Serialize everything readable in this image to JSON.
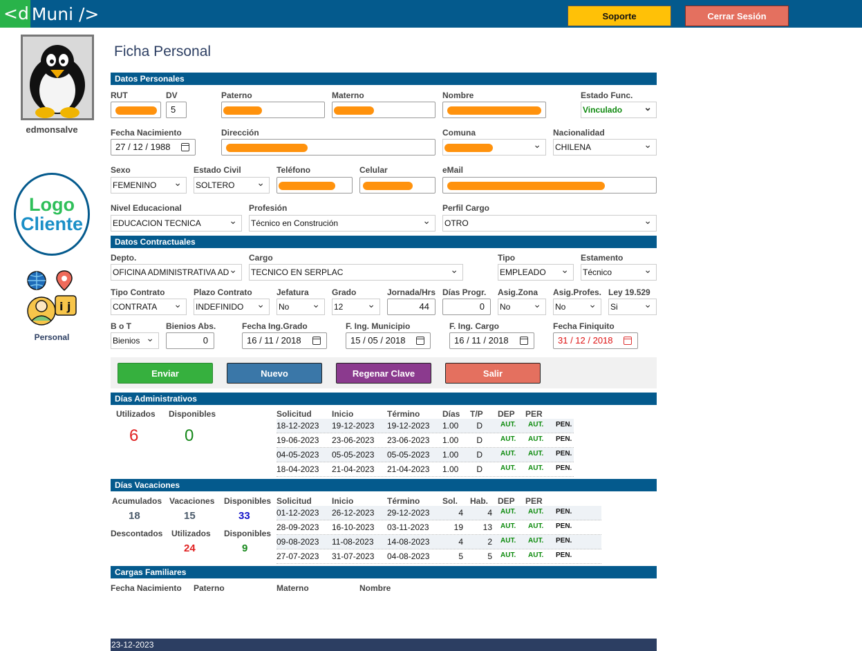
{
  "app": {
    "logo_tag": "<d",
    "logo_rest": "Muni />"
  },
  "header": {
    "support_label": "Soporte",
    "logout_label": "Cerrar Sesión"
  },
  "colors": {
    "primary": "#045a8d",
    "navy": "#2c3e62",
    "support": "#ffc107",
    "logout": "#e4705f",
    "send": "#36b03e",
    "new": "#3a77a8",
    "regen": "#8b3a8e",
    "exit": "#e4705f"
  },
  "sidebar": {
    "username": "edmonsalve",
    "client_logo_line1": "Logo",
    "client_logo_line2": "Cliente",
    "personal_label": "Personal"
  },
  "page": {
    "title": "Ficha Personal"
  },
  "personal": {
    "section": "Datos Personales",
    "rut_label": "RUT",
    "dv_label": "DV",
    "dv": "5",
    "paterno_label": "Paterno",
    "materno_label": "Materno",
    "nombre_label": "Nombre",
    "estado_label": "Estado Func.",
    "estado": "Vinculado",
    "fnac_label": "Fecha Nacimiento",
    "fnac": "27 / 12 / 1988",
    "direccion_label": "Dirección",
    "comuna_label": "Comuna",
    "nacionalidad_label": "Nacionalidad",
    "nacionalidad": "CHILENA",
    "sexo_label": "Sexo",
    "sexo": "FEMENINO",
    "civil_label": "Estado Civil",
    "civil": "SOLTERO",
    "telefono_label": "Teléfono",
    "celular_label": "Celular",
    "email_label": "eMail",
    "nivel_label": "Nivel Educacional",
    "nivel": "EDUCACION TECNICA",
    "profesion_label": "Profesión",
    "profesion": "Técnico en Construción",
    "perfil_label": "Perfil Cargo",
    "perfil": "OTRO"
  },
  "contract": {
    "section": "Datos Contractuales",
    "depto_label": "Depto.",
    "depto": "OFICINA ADMINISTRATIVA AD",
    "cargo_label": "Cargo",
    "cargo": "TECNICO EN SERPLAC",
    "tipo_label": "Tipo",
    "tipo": "EMPLEADO",
    "estamento_label": "Estamento",
    "estamento": "Técnico",
    "tipo_contrato_label": "Tipo Contrato",
    "tipo_contrato": "CONTRATA",
    "plazo_label": "Plazo Contrato",
    "plazo": "INDEFINIDO",
    "jefatura_label": "Jefatura",
    "jefatura": "No",
    "grado_label": "Grado",
    "grado": "12",
    "jornada_label": "Jornada/Hrs",
    "jornada": "44",
    "dias_progr_label": "Días Progr.",
    "dias_progr": "0",
    "asig_zona_label": "Asig.Zona",
    "asig_zona": "No",
    "asig_prof_label": "Asig.Profes.",
    "asig_prof": "No",
    "ley_label": "Ley 19.529",
    "ley": "Si",
    "bot_label": "B o T",
    "bot": "Bienios",
    "bienios_label": "Bienios Abs.",
    "bienios": "0",
    "f_grado_label": "Fecha Ing.Grado",
    "f_grado": "16 / 11 / 2018",
    "f_muni_label": "F. Ing. Municipio",
    "f_muni": "15 / 05 / 2018",
    "f_cargo_label": "F. Ing. Cargo",
    "f_cargo": "16 / 11 / 2018",
    "f_fin_label": "Fecha Finiquito",
    "f_fin": "31 / 12 / 2018"
  },
  "actions": {
    "send": "Enviar",
    "new": "Nuevo",
    "regen": "Regenar Clave",
    "exit": "Salir"
  },
  "admin_days": {
    "section": "Días Administrativos",
    "used_label": "Utilizados",
    "used": "6",
    "avail_label": "Disponibles",
    "avail": "0",
    "headers": [
      "Solicitud",
      "Inicio",
      "Término",
      "Días",
      "T/P",
      "DEP",
      "PER"
    ],
    "rows": [
      [
        "18-12-2023",
        "19-12-2023",
        "19-12-2023",
        "1.00",
        "D",
        "AUT.",
        "AUT.",
        "PEN."
      ],
      [
        "19-06-2023",
        "23-06-2023",
        "23-06-2023",
        "1.00",
        "D",
        "AUT.",
        "AUT.",
        "PEN."
      ],
      [
        "04-05-2023",
        "05-05-2023",
        "05-05-2023",
        "1.00",
        "D",
        "AUT.",
        "AUT.",
        "PEN."
      ],
      [
        "18-04-2023",
        "21-04-2023",
        "21-04-2023",
        "1.00",
        "D",
        "AUT.",
        "AUT.",
        "PEN."
      ]
    ]
  },
  "vacations": {
    "section": "Días Vacaciones",
    "acum_label": "Acumulados",
    "acum": "18",
    "vac_label": "Vacaciones",
    "vac": "15",
    "disp1_label": "Disponibles",
    "disp1": "33",
    "desc_label": "Descontados",
    "util_label": "Utilizados",
    "util": "24",
    "disp2_label": "Disponibles",
    "disp2": "9",
    "headers": [
      "Solicitud",
      "Inicio",
      "Término",
      "Sol.",
      "Hab.",
      "DEP",
      "PER"
    ],
    "rows": [
      [
        "01-12-2023",
        "26-12-2023",
        "29-12-2023",
        "4",
        "4",
        "AUT.",
        "AUT.",
        "PEN."
      ],
      [
        "28-09-2023",
        "16-10-2023",
        "03-11-2023",
        "19",
        "13",
        "AUT.",
        "AUT.",
        "PEN."
      ],
      [
        "09-08-2023",
        "11-08-2023",
        "14-08-2023",
        "4",
        "2",
        "AUT.",
        "AUT.",
        "PEN."
      ],
      [
        "27-07-2023",
        "31-07-2023",
        "04-08-2023",
        "5",
        "5",
        "AUT.",
        "AUT.",
        "PEN."
      ]
    ]
  },
  "family": {
    "section": "Cargas Familiares",
    "headers": [
      "Fecha Nacimiento",
      "Paterno",
      "Materno",
      "Nombre"
    ]
  },
  "footer": {
    "date": "23-12-2023"
  }
}
